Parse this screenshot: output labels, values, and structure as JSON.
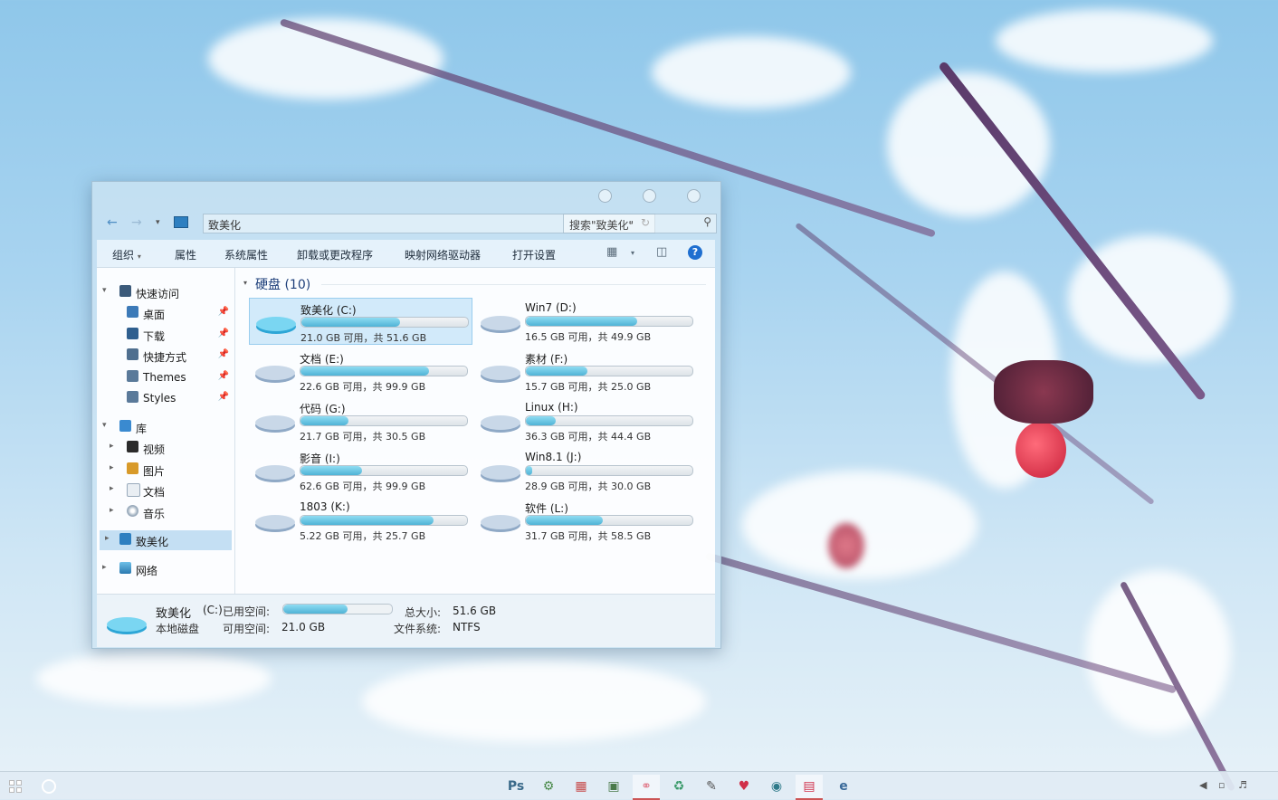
{
  "window": {
    "address_text": "致美化",
    "search_placeholder": "搜索\"致美化\""
  },
  "toolbar": {
    "organize": "组织",
    "properties": "属性",
    "system_properties": "系统属性",
    "uninstall": "卸载或更改程序",
    "map_drive": "映射网络驱动器",
    "open_settings": "打开设置"
  },
  "sidebar": {
    "quick_access": "快速访问",
    "desktop": "桌面",
    "downloads": "下载",
    "shortcuts": "快捷方式",
    "themes": "Themes",
    "styles": "Styles",
    "library": "库",
    "videos": "视频",
    "pictures": "图片",
    "documents": "文档",
    "music": "音乐",
    "this_pc": "致美化",
    "network": "网络"
  },
  "content": {
    "group_title": "硬盘 (10)",
    "drives": [
      {
        "name": "致美化 (C:)",
        "free": "21.0 GB 可用，共 51.6 GB",
        "used_frac": 0.59
      },
      {
        "name": "Win7 (D:)",
        "free": "16.5 GB 可用，共 49.9 GB",
        "used_frac": 0.67
      },
      {
        "name": "文档 (E:)",
        "free": "22.6 GB 可用，共 99.9 GB",
        "used_frac": 0.77
      },
      {
        "name": "素材 (F:)",
        "free": "15.7 GB 可用，共 25.0 GB",
        "used_frac": 0.37
      },
      {
        "name": "代码 (G:)",
        "free": "21.7 GB 可用，共 30.5 GB",
        "used_frac": 0.29
      },
      {
        "name": "Linux (H:)",
        "free": "36.3 GB 可用，共 44.4 GB",
        "used_frac": 0.18
      },
      {
        "name": "影音 (I:)",
        "free": "62.6 GB 可用，共 99.9 GB",
        "used_frac": 0.37
      },
      {
        "name": "Win8.1 (J:)",
        "free": "28.9 GB 可用，共 30.0 GB",
        "used_frac": 0.04
      },
      {
        "name": "1803 (K:)",
        "free": "5.22 GB 可用，共 25.7 GB",
        "used_frac": 0.8
      },
      {
        "name": "软件 (L:)",
        "free": "31.7 GB 可用，共 58.5 GB",
        "used_frac": 0.46
      }
    ]
  },
  "details": {
    "drive_name": "致美化",
    "drive_letter": "(C:)",
    "drive_type": "本地磁盘",
    "used_label": "已用空间:",
    "free_label": "可用空间:",
    "free_value": "21.0 GB",
    "total_label": "总大小:",
    "total_value": "51.6 GB",
    "fs_label": "文件系统:",
    "fs_value": "NTFS",
    "used_frac": 0.59
  },
  "taskbar": {
    "ps_label": "Ps",
    "ie_label": "e"
  }
}
